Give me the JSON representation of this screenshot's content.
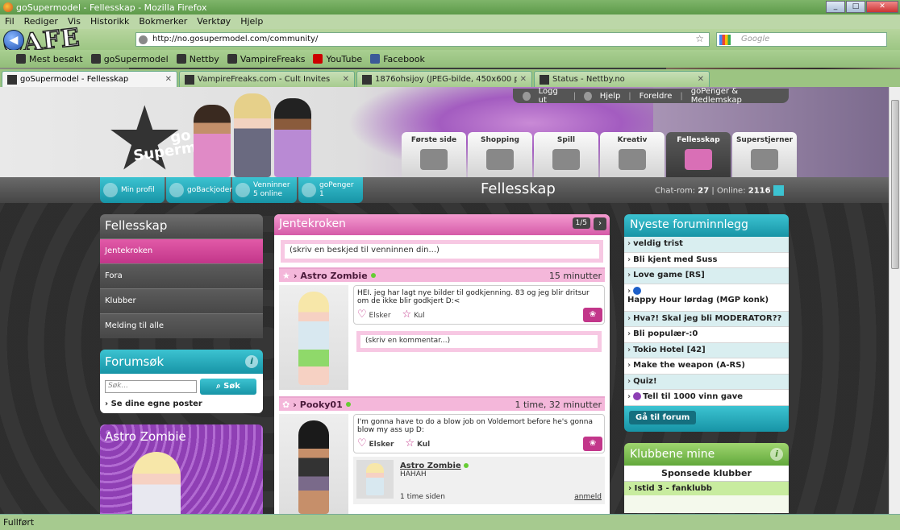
{
  "window": {
    "title": "goSupermodel - Fellesskap - Mozilla Firefox"
  },
  "menu": [
    "Fil",
    "Rediger",
    "Vis",
    "Historikk",
    "Bokmerker",
    "Verktøy",
    "Hjelp"
  ],
  "address": {
    "url": "http://no.gosupermodel.com/community/",
    "search_placeholder": "Google"
  },
  "overlay_text": "CAFE",
  "bookmarks": [
    "Mest besøkt",
    "goSupermodel",
    "Nettby",
    "VampireFreaks",
    "YouTube",
    "Facebook"
  ],
  "tabs": [
    {
      "label": "goSupermodel - Fellesskap",
      "active": true
    },
    {
      "label": "VampireFreaks.com - Cult Invites",
      "active": false
    },
    {
      "label": "1876ohsijoy (JPEG-bilde, 450x600 p...",
      "active": false
    },
    {
      "label": "Status - Nettby.no",
      "active": false
    }
  ],
  "status": "Fullført",
  "site": {
    "logo_line1": "go",
    "logo_line2": "Supermodel",
    "toplinks": [
      "Logg ut",
      "Hjelp",
      "Foreldre",
      "goPenger & Medlemskap"
    ],
    "nav": [
      {
        "label": "Første side",
        "icon": "diamond-icon"
      },
      {
        "label": "Shopping",
        "icon": "shopping-bag-icon"
      },
      {
        "label": "Spill",
        "icon": "gamepad-icon"
      },
      {
        "label": "Kreativ",
        "icon": "paint-icon"
      },
      {
        "label": "Fellesskap",
        "icon": "chat-icon",
        "active": true
      },
      {
        "label": "Superstjerner",
        "icon": "star-icon"
      }
    ],
    "quick": [
      {
        "l1": "Min profil",
        "l2": "",
        "icon": "profile-icon"
      },
      {
        "l1": "goBackjoder",
        "l2": "",
        "icon": "mail-icon"
      },
      {
        "l1": "Venninner",
        "l2": "5 online",
        "icon": "heart-icon"
      },
      {
        "l1": "goPenger",
        "l2": "1",
        "icon": "money-icon"
      }
    ],
    "page_title": "Fellesskap",
    "chat_label": "Chat-rom:",
    "chat_count": "27",
    "online_label": "Online:",
    "online_count": "2116"
  },
  "left": {
    "title": "Fellesskap",
    "nav": [
      "Jentekroken",
      "Fora",
      "Klubber",
      "Melding til alle"
    ],
    "search": {
      "title": "Forumsøk",
      "placeholder": "Søk...",
      "button": "Søk",
      "link": "Se dine egne poster"
    },
    "profile_title": "Astro Zombie"
  },
  "center": {
    "title": "Jentekroken",
    "pager": "1/5",
    "message_placeholder": "(skriv en beskjed til venninnen din...)",
    "posts": [
      {
        "user": "Astro Zombie",
        "time": "15 minutter",
        "text": "HEI. jeg har lagt nye bilder til godkjenning. 83 og jeg blir dritsur om de ikke blir godkjert D:<",
        "like": "Elsker",
        "cool": "Kul",
        "comment_placeholder": "(skriv en kommentar...)"
      },
      {
        "user": "Pooky01",
        "time": "1 time, 32 minutter",
        "text": "I'm gonna have to do a blow job on Voldemort before he's gonna blow my ass up D:",
        "like": "Elsker",
        "cool": "Kul",
        "reply": {
          "user": "Astro Zombie",
          "text": "HAHAH",
          "time": "1 time siden",
          "action": "anmeld"
        }
      }
    ]
  },
  "right": {
    "forum_title": "Nyeste foruminnlegg",
    "forum_items": [
      "veldig trist",
      "Bli kjent med Suss",
      "Love game [RS]",
      "Happy Hour lørdag (MGP konk)",
      "Hva?! Skal jeg bli MODERATOR??",
      "Bli populær-:0",
      "Tokio Hotel [42]",
      "Make the weapon (A-RS)",
      "Quiz!",
      "Tell til 1000 vinn gave"
    ],
    "forum_button": "Gå til forum",
    "clubs_title": "Klubbene mine",
    "clubs_sub": "Sponsede klubber",
    "clubs_items": [
      "Istid 3 - fanklubb"
    ]
  },
  "colors": {
    "pink": "#d55aa8",
    "teal": "#1794a6",
    "green": "#62a83c"
  }
}
